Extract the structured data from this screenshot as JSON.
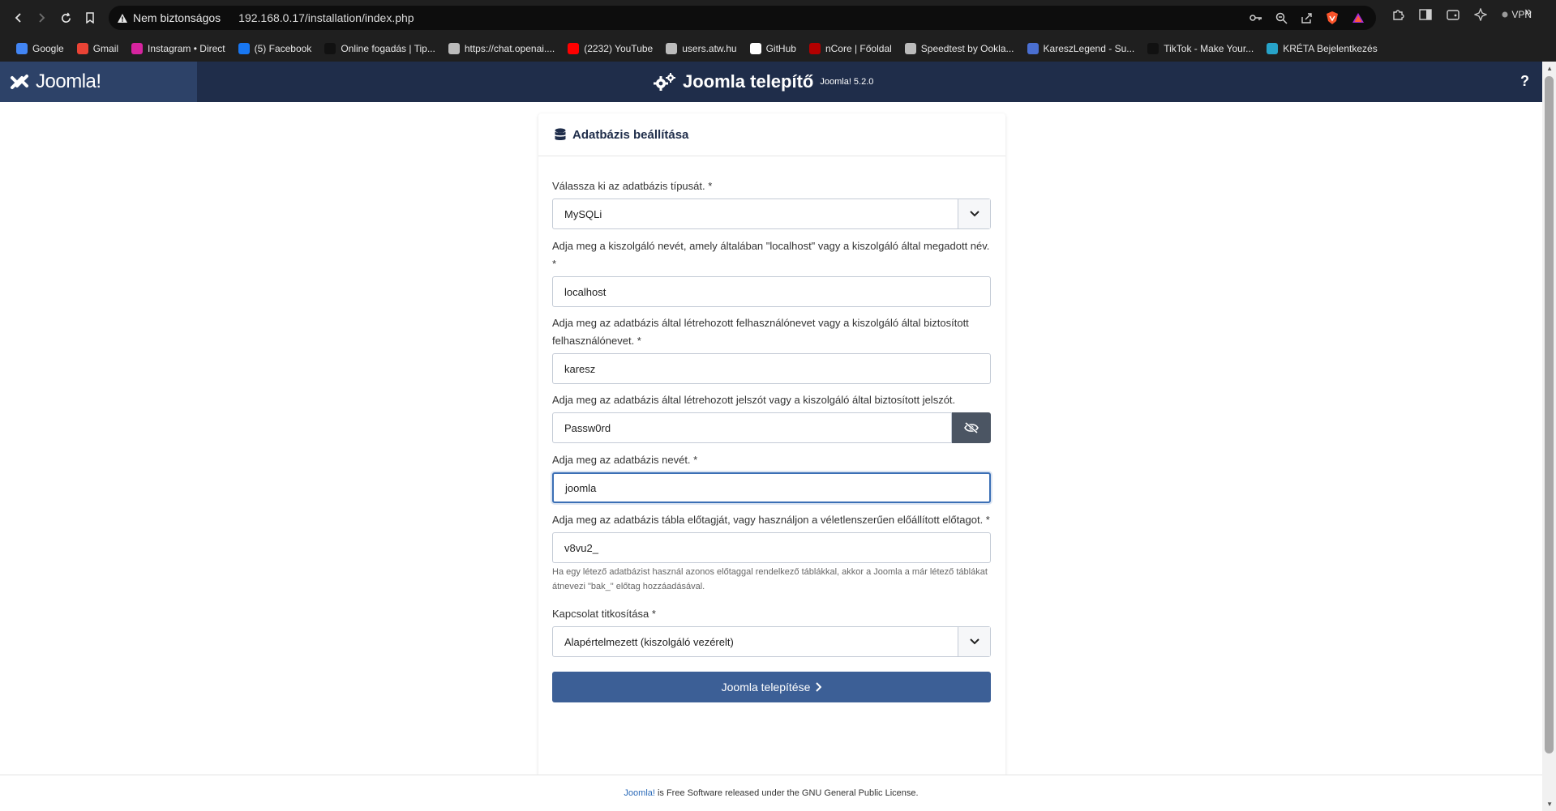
{
  "browser": {
    "security_label": "Nem biztonságos",
    "url": "192.168.0.17/installation/index.php",
    "vpn_label": "VPN"
  },
  "bookmarks": [
    {
      "label": "Google",
      "icon": "google-icon",
      "color": "#4285f4"
    },
    {
      "label": "Gmail",
      "icon": "gmail-icon",
      "color": "#ea4335"
    },
    {
      "label": "Instagram • Direct",
      "icon": "instagram-icon",
      "color": "#d6249f"
    },
    {
      "label": "(5) Facebook",
      "icon": "facebook-icon",
      "color": "#1877f2"
    },
    {
      "label": "Online fogadás | Tip...",
      "icon": "tippmix-icon",
      "color": "#111111"
    },
    {
      "label": "https://chat.openai....",
      "icon": "openai-icon",
      "color": "#bbbbbb"
    },
    {
      "label": "(2232) YouTube",
      "icon": "youtube-icon",
      "color": "#ff0000"
    },
    {
      "label": "users.atw.hu",
      "icon": "globe-icon",
      "color": "#bbbbbb"
    },
    {
      "label": "GitHub",
      "icon": "github-icon",
      "color": "#ffffff"
    },
    {
      "label": "nCore | Főoldal",
      "icon": "ncore-icon",
      "color": "#b30000"
    },
    {
      "label": "Speedtest by Ookla...",
      "icon": "speedtest-icon",
      "color": "#bbbbbb"
    },
    {
      "label": "KareszLegend - Su...",
      "icon": "kareszlegend-icon",
      "color": "#4a6fd1"
    },
    {
      "label": "TikTok - Make Your...",
      "icon": "tiktok-icon",
      "color": "#111111"
    },
    {
      "label": "KRÉTA Bejelentkezés",
      "icon": "kreta-icon",
      "color": "#27a3c9"
    }
  ],
  "joomla": {
    "logo_text": "Joomla!",
    "title": "Joomla telepítő",
    "version": "Joomla! 5.2.0",
    "help": "?"
  },
  "card": {
    "title": "Adatbázis beállítása"
  },
  "form": {
    "db_type_label": "Válassza ki az adatbázis típusát. *",
    "db_type_value": "MySQLi",
    "host_label": "Adja meg a kiszolgáló nevét, amely általában \"localhost\" vagy a kiszolgáló által megadott név. *",
    "host_value": "localhost",
    "user_label": "Adja meg az adatbázis által létrehozott felhasználónevet vagy a kiszolgáló által biztosított felhasználónevet. *",
    "user_value": "karesz",
    "password_label": "Adja meg az adatbázis által létrehozott jelszót vagy a kiszolgáló által biztosított jelszót.",
    "password_value": "Passw0rd",
    "db_name_label": "Adja meg az adatbázis nevét. *",
    "db_name_value": "joomla",
    "prefix_label": "Adja meg az adatbázis tábla előtagját, vagy használjon a véletlenszerűen előállított előtagot. *",
    "prefix_value": "v8vu2_",
    "prefix_hint": "Ha egy létező adatbázist használ azonos előtaggal rendelkező táblákkal, akkor a Joomla a már létező táblákat átnevezi \"bak_\" előtag hozzáadásával.",
    "encryption_label": "Kapcsolat titkosítása *",
    "encryption_value": "Alapértelmezett (kiszolgáló vezérelt)",
    "install_button": "Joomla telepítése"
  },
  "footer": {
    "link": "Joomla!",
    "text": "is Free Software released under the GNU General Public License."
  },
  "colors": {
    "header_bg": "#1f2d4a",
    "logo_bg": "#2d4268",
    "button_bg": "#3c5f96",
    "focus_border": "#3b6fb5"
  }
}
